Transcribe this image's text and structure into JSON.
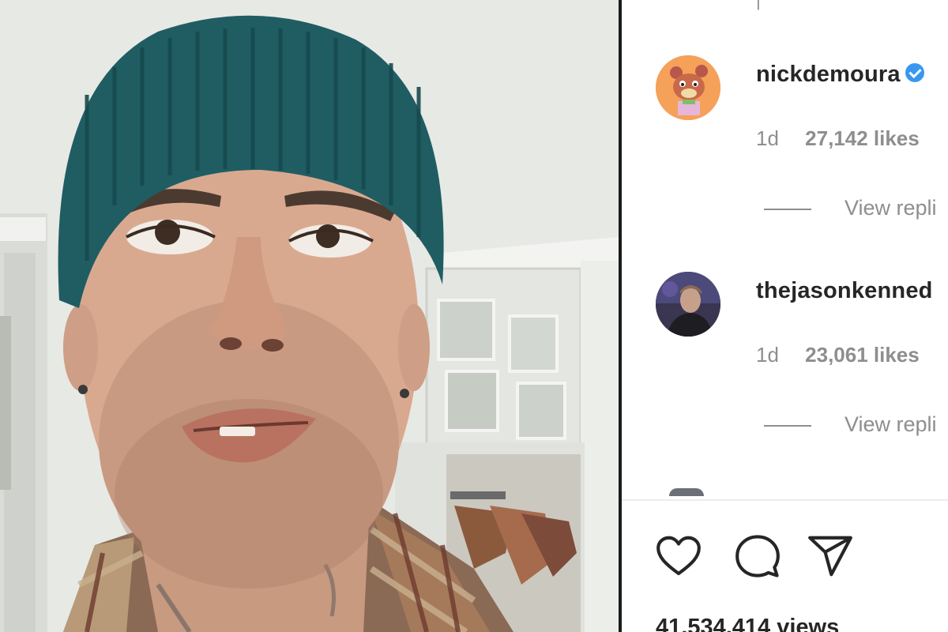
{
  "comments": [
    {
      "username": "nickdemoura",
      "verified": true,
      "time": "1d",
      "likes": "27,142 likes",
      "view_replies": "View repli",
      "avatar_icon": "cartoon-bear-avatar-icon"
    },
    {
      "username": "thejasonkenned",
      "verified": false,
      "time": "1d",
      "likes": "23,061 likes",
      "view_replies": "View repli",
      "avatar_icon": "person-photo-avatar-icon"
    }
  ],
  "actions": {
    "like_icon": "heart-icon",
    "comment_icon": "speech-bubble-icon",
    "share_icon": "paper-plane-icon"
  },
  "views": "41,534,414 views",
  "colors": {
    "text": "#262626",
    "muted": "#8e8e8e",
    "verified": "#3897f0",
    "hat": "#1f5d63"
  }
}
